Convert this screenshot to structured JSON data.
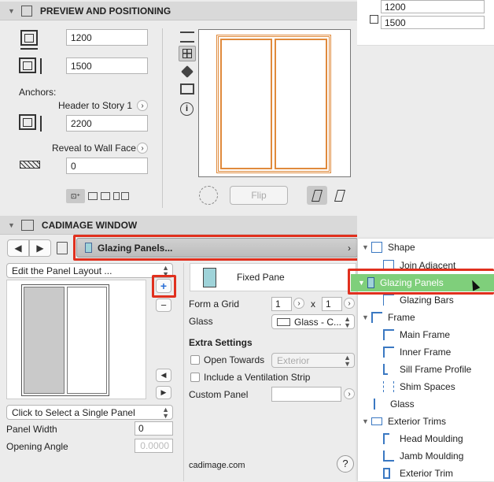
{
  "preview": {
    "title": "PREVIEW AND POSITIONING",
    "width": "1200",
    "height": "1500",
    "anchors_label": "Anchors:",
    "header_anchor": "Header to Story 1",
    "header_value": "2200",
    "reveal_anchor": "Reveal to Wall Face",
    "reveal_value": "0",
    "flip_label": "Flip"
  },
  "right_top": {
    "width": "1200",
    "height": "1500"
  },
  "cadimage": {
    "title": "CADIMAGE WINDOW",
    "nav_label": "Glazing Panels...",
    "edit_mode": "Edit the Panel Layout ...",
    "pane_type": "Fixed Pane",
    "form_grid_label": "Form a Grid",
    "grid_cols": "1",
    "grid_x": "x",
    "grid_rows": "1",
    "glass_label": "Glass",
    "glass_value": "Glass - C...",
    "extra_settings": "Extra Settings",
    "open_towards_label": "Open Towards",
    "open_towards_value": "Exterior",
    "ventilation_label": "Include a Ventilation Strip",
    "custom_panel_label": "Custom Panel",
    "select_panel": "Click to Select a Single Panel",
    "panel_width_label": "Panel Width",
    "panel_width_value": "0",
    "opening_angle_label": "Opening Angle",
    "opening_angle_value": "0.0000",
    "footer": "cadimage.com",
    "help": "?",
    "plus": "+",
    "minus": "−"
  },
  "tree": {
    "items": [
      {
        "label": "Shape"
      },
      {
        "label": "Join Adjacent"
      },
      {
        "label": "Glazing Panels"
      },
      {
        "label": "Glazing Bars"
      },
      {
        "label": "Frame"
      },
      {
        "label": "Main Frame"
      },
      {
        "label": "Inner Frame"
      },
      {
        "label": "Sill Frame Profile"
      },
      {
        "label": "Shim Spaces"
      },
      {
        "label": "Glass"
      },
      {
        "label": "Exterior Trims"
      },
      {
        "label": "Head Moulding"
      },
      {
        "label": "Jamb Moulding"
      },
      {
        "label": "Exterior Trim"
      }
    ]
  },
  "colors": {
    "selection": "#7fcf7b",
    "highlight": "#e0301e",
    "window_frame": "#e08a3c"
  }
}
